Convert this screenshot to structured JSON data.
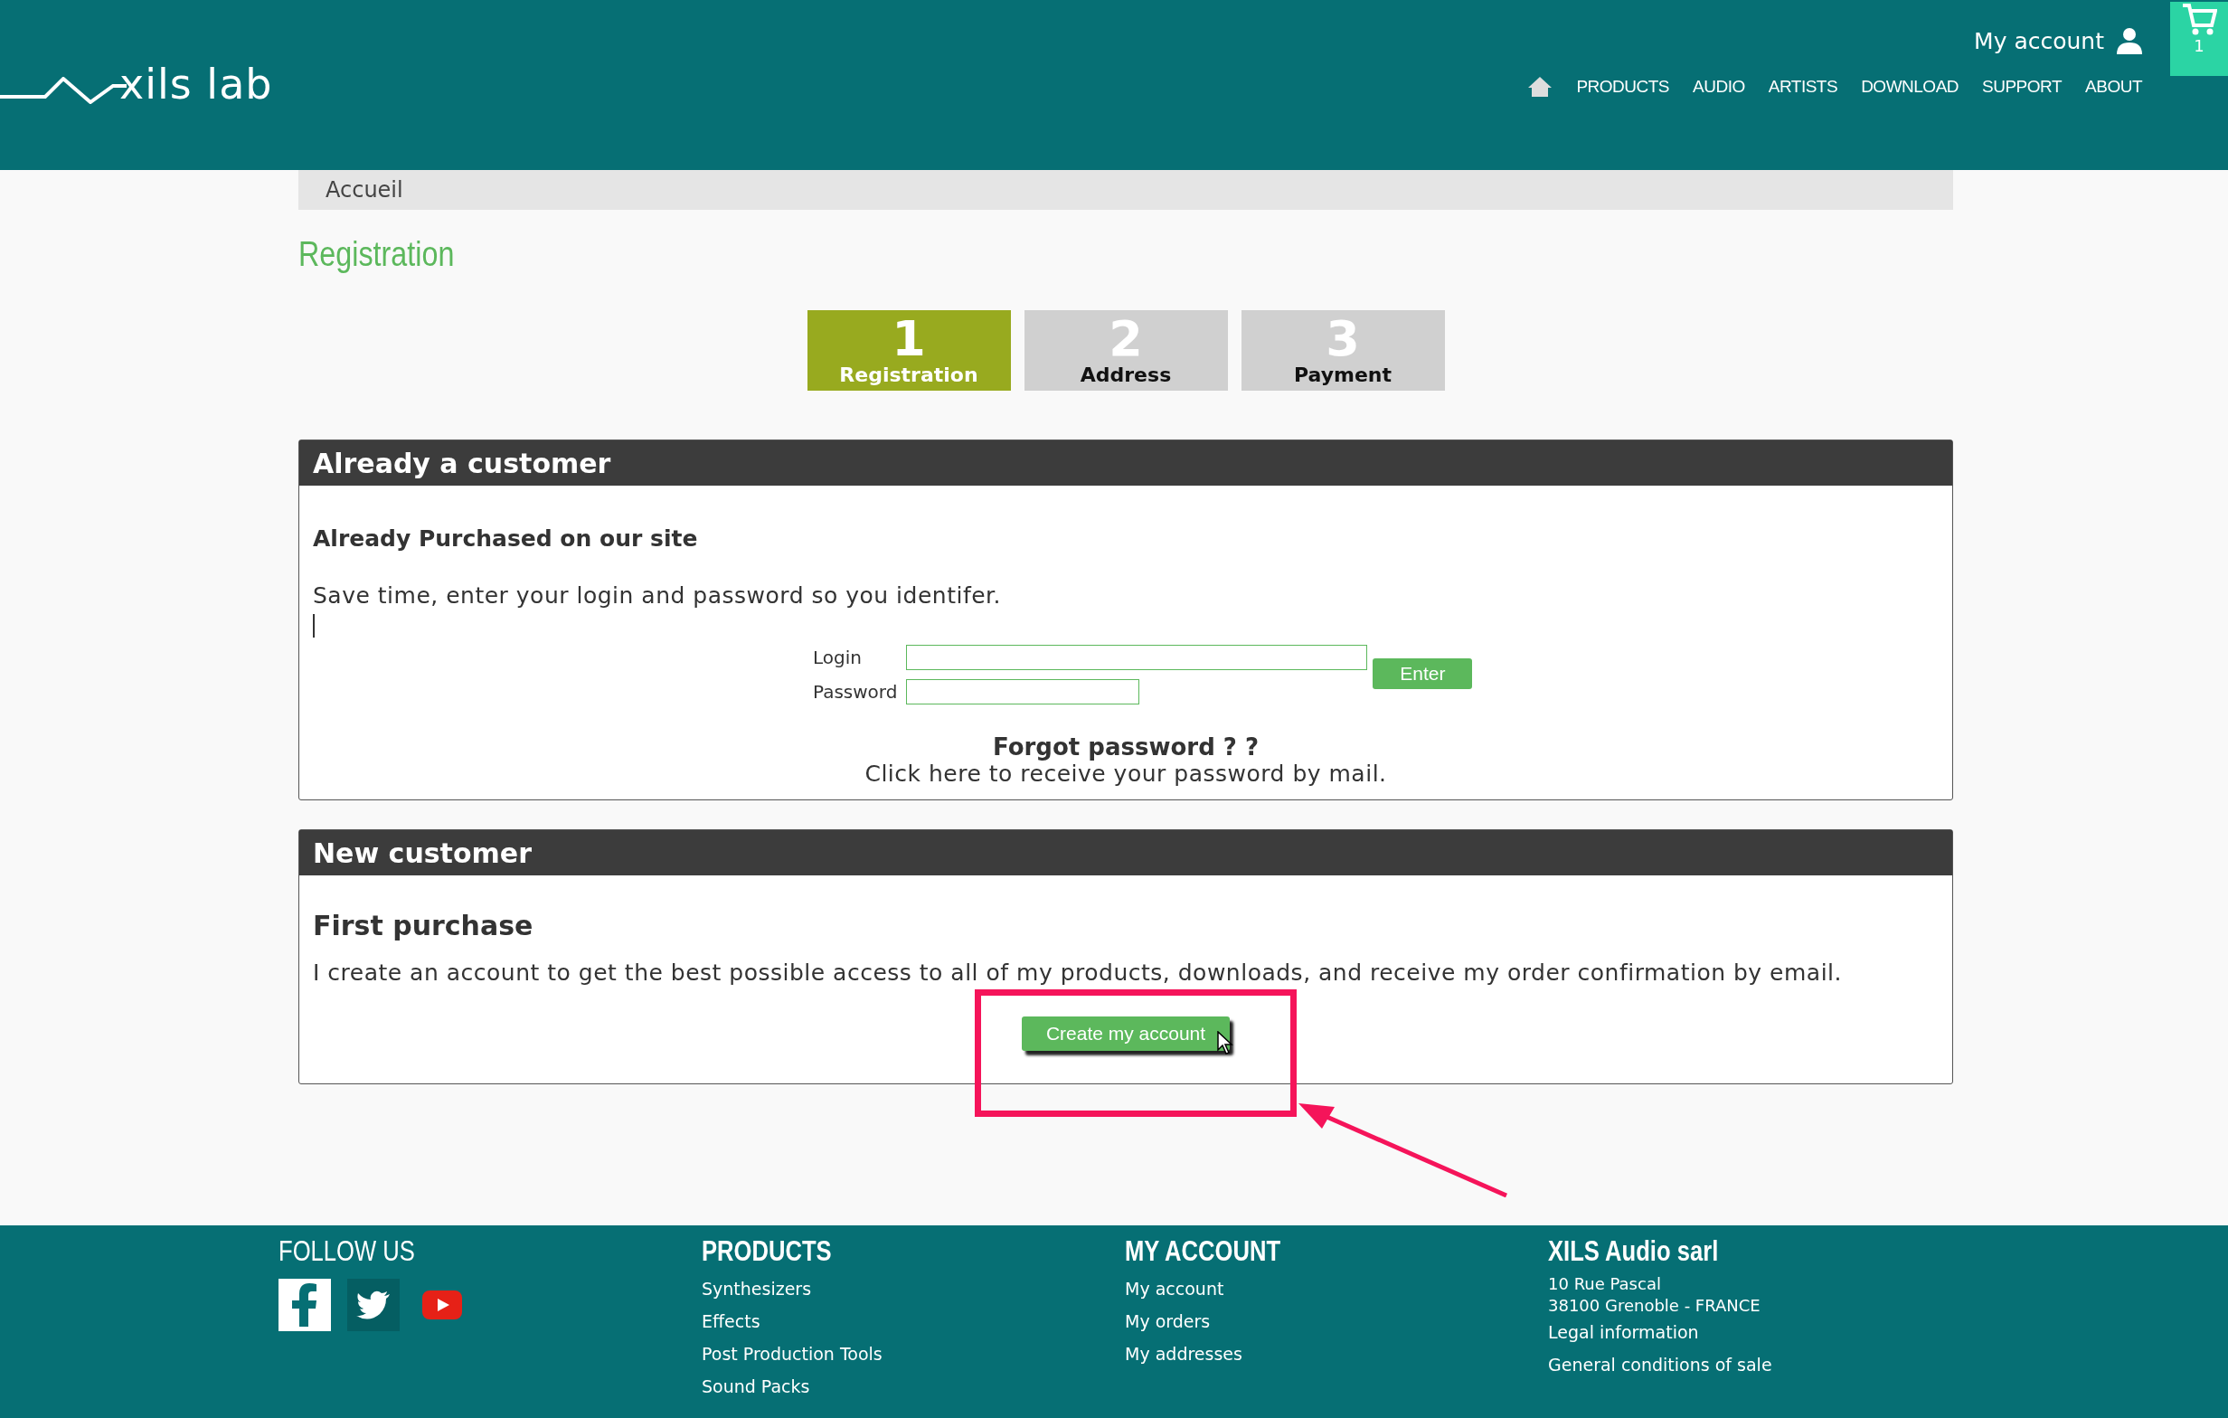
{
  "header": {
    "logo": "xils lab",
    "account_link": "My account",
    "cart_count": "1",
    "nav": [
      {
        "label": "PRODUCTS"
      },
      {
        "label": "AUDIO"
      },
      {
        "label": "ARTISTS"
      },
      {
        "label": "DOWNLOAD"
      },
      {
        "label": "SUPPORT"
      },
      {
        "label": "ABOUT"
      }
    ]
  },
  "breadcrumb": "Accueil",
  "page_title": "Registration",
  "steps": [
    {
      "number": "1",
      "label": "Registration",
      "selected": true
    },
    {
      "number": "2",
      "label": "Address",
      "selected": false
    },
    {
      "number": "3",
      "label": "Payment",
      "selected": false
    }
  ],
  "existing_customer": {
    "title": "Already a customer",
    "subtitle": "Already Purchased on our site",
    "text": "Save time, enter your login and password so you identifer.",
    "login_label": "Login",
    "password_label": "Password",
    "submit": "Enter",
    "forgot_title": "Forgot password ? ?",
    "forgot_link": "Click here to receive your password by mail."
  },
  "new_customer": {
    "title": "New customer",
    "subtitle": "First purchase",
    "text": "I create an account to get the best possible access to all of my products, downloads, and receive my order confirmation by email.",
    "button": "Create my account"
  },
  "footer": {
    "follow_title": "FOLLOW US",
    "columns": [
      {
        "title": "PRODUCTS",
        "links": [
          "Synthesizers",
          "Effects",
          "Post Production Tools",
          "Sound Packs"
        ]
      },
      {
        "title": "MY ACCOUNT",
        "links": [
          "My account",
          "My orders",
          "My addresses"
        ]
      }
    ],
    "company": {
      "title": "XILS Audio sarl",
      "address": [
        "10 Rue Pascal",
        "38100 Grenoble - FRANCE"
      ],
      "links": [
        "Legal information",
        "General conditions of sale"
      ]
    }
  }
}
